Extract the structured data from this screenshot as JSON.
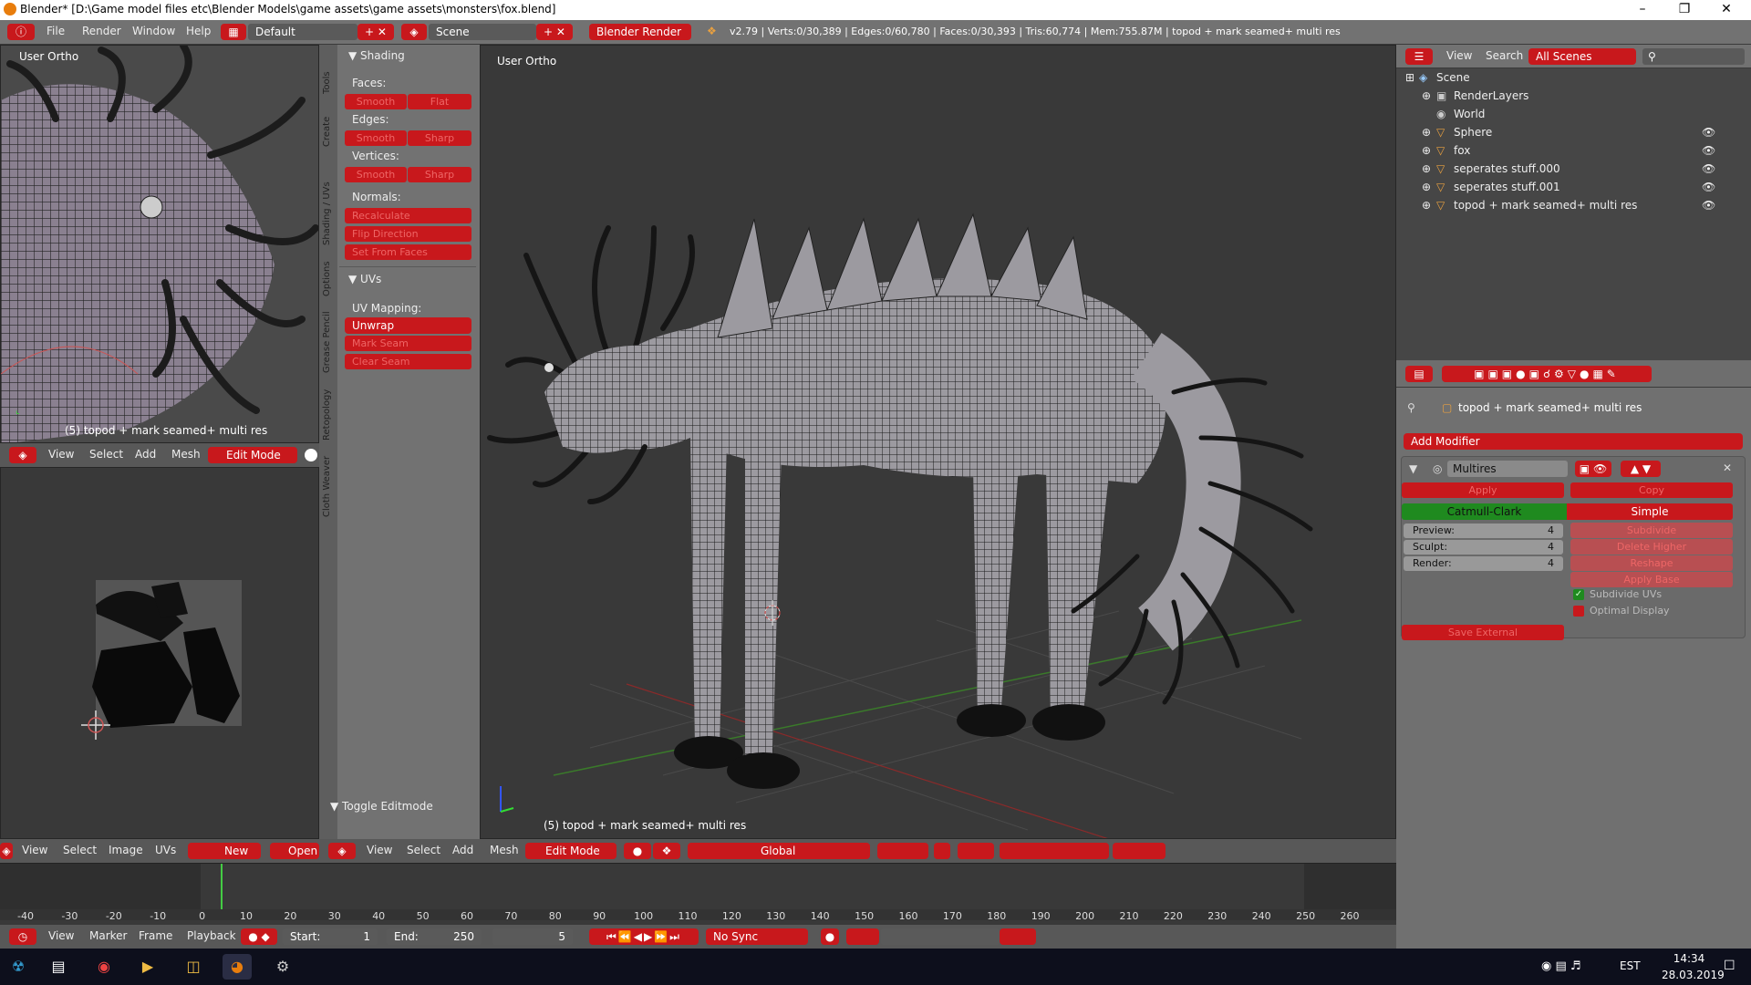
{
  "window": {
    "title": "Blender* [D:\\Game model files etc\\Blender Models\\game assets\\game assets\\monsters\\fox.blend]",
    "min_icon": "minimize-icon",
    "max_icon": "maximize-icon",
    "close_icon": "close-icon"
  },
  "topbar": {
    "menus": [
      "File",
      "Render",
      "Window",
      "Help"
    ],
    "layout": "Default",
    "scene": "Scene",
    "engine": "Blender Render",
    "stats": "v2.79 | Verts:0/30,389 | Edges:0/60,780 | Faces:0/30,393 | Tris:60,774 | Mem:755.87M | topod + mark seamed+ multi res"
  },
  "viewport_small": {
    "label": "User Ortho",
    "object_label": "(5) topod + mark seamed+ multi res"
  },
  "viewport_small_header": {
    "view": "View",
    "select": "Select",
    "add": "Add",
    "mesh": "Mesh",
    "mode": "Edit Mode"
  },
  "uv_header": {
    "view": "View",
    "select": "Select",
    "image": "Image",
    "uvs": "UVs",
    "new": "New",
    "open": "Open"
  },
  "toolshelf": {
    "tabs": [
      "Tools",
      "Create",
      "Shading / UVs",
      "Options",
      "Grease Pencil",
      "Retopology",
      "Cloth Weaver"
    ],
    "shading_title": "Shading",
    "faces_label": "Faces:",
    "edges_label": "Edges:",
    "vertices_label": "Vertices:",
    "smooth": "Smooth",
    "flat": "Flat",
    "sharp": "Sharp",
    "normals_label": "Normals:",
    "recalculate": "Recalculate",
    "flip_direction": "Flip Direction",
    "set_from_faces": "Set From Faces",
    "uvs_title": "UVs",
    "uv_mapping_label": "UV Mapping:",
    "unwrap": "Unwrap",
    "mark_seam": "Mark Seam",
    "clear_seam": "Clear Seam",
    "toggle_editmode": "Toggle Editmode"
  },
  "viewport_main": {
    "label": "User Ortho",
    "object_label": "(5) topod + mark seamed+ multi res"
  },
  "viewport_main_header": {
    "view": "View",
    "select": "Select",
    "add": "Add",
    "mesh": "Mesh",
    "mode": "Edit Mode",
    "orientation": "Global"
  },
  "timeline": {
    "ticks": [
      "-40",
      "-30",
      "-20",
      "-10",
      "0",
      "10",
      "20",
      "30",
      "40",
      "50",
      "60",
      "70",
      "80",
      "90",
      "100",
      "110",
      "120",
      "130",
      "140",
      "150",
      "160",
      "170",
      "180",
      "190",
      "200",
      "210",
      "220",
      "230",
      "240",
      "250",
      "260"
    ],
    "view": "View",
    "marker": "Marker",
    "frame": "Frame",
    "playback": "Playback",
    "start_label": "Start:",
    "start": "1",
    "end_label": "End:",
    "end": "250",
    "current": "5",
    "sync": "No Sync"
  },
  "outliner": {
    "view": "View",
    "search": "Search",
    "filter": "All Scenes",
    "items": [
      {
        "name": "Scene"
      },
      {
        "name": "RenderLayers"
      },
      {
        "name": "World"
      },
      {
        "name": "Sphere"
      },
      {
        "name": "fox"
      },
      {
        "name": "seperates stuff.000"
      },
      {
        "name": "seperates stuff.001"
      },
      {
        "name": "topod + mark seamed+ multi res"
      }
    ]
  },
  "properties": {
    "object_name": "topod + mark seamed+ multi res",
    "add_modifier": "Add Modifier",
    "modifier_name": "Multires",
    "apply": "Apply",
    "copy": "Copy",
    "catmull_clark": "Catmull-Clark",
    "simple": "Simple",
    "preview_label": "Preview:",
    "preview": "4",
    "sculpt_label": "Sculpt:",
    "sculpt": "4",
    "render_label": "Render:",
    "render": "4",
    "subdivide": "Subdivide",
    "delete_higher": "Delete Higher",
    "reshape": "Reshape",
    "apply_base": "Apply Base",
    "subdivide_uvs": "Subdivide UVs",
    "optimal_display": "Optimal Display",
    "save_external": "Save External"
  },
  "taskbar": {
    "lang": "EST",
    "time": "14:34",
    "date": "28.03.2019"
  },
  "colors": {
    "accent_red": "#c8181c",
    "panel": "#727272",
    "viewport": "#393939",
    "green": "#1f8a1f"
  }
}
